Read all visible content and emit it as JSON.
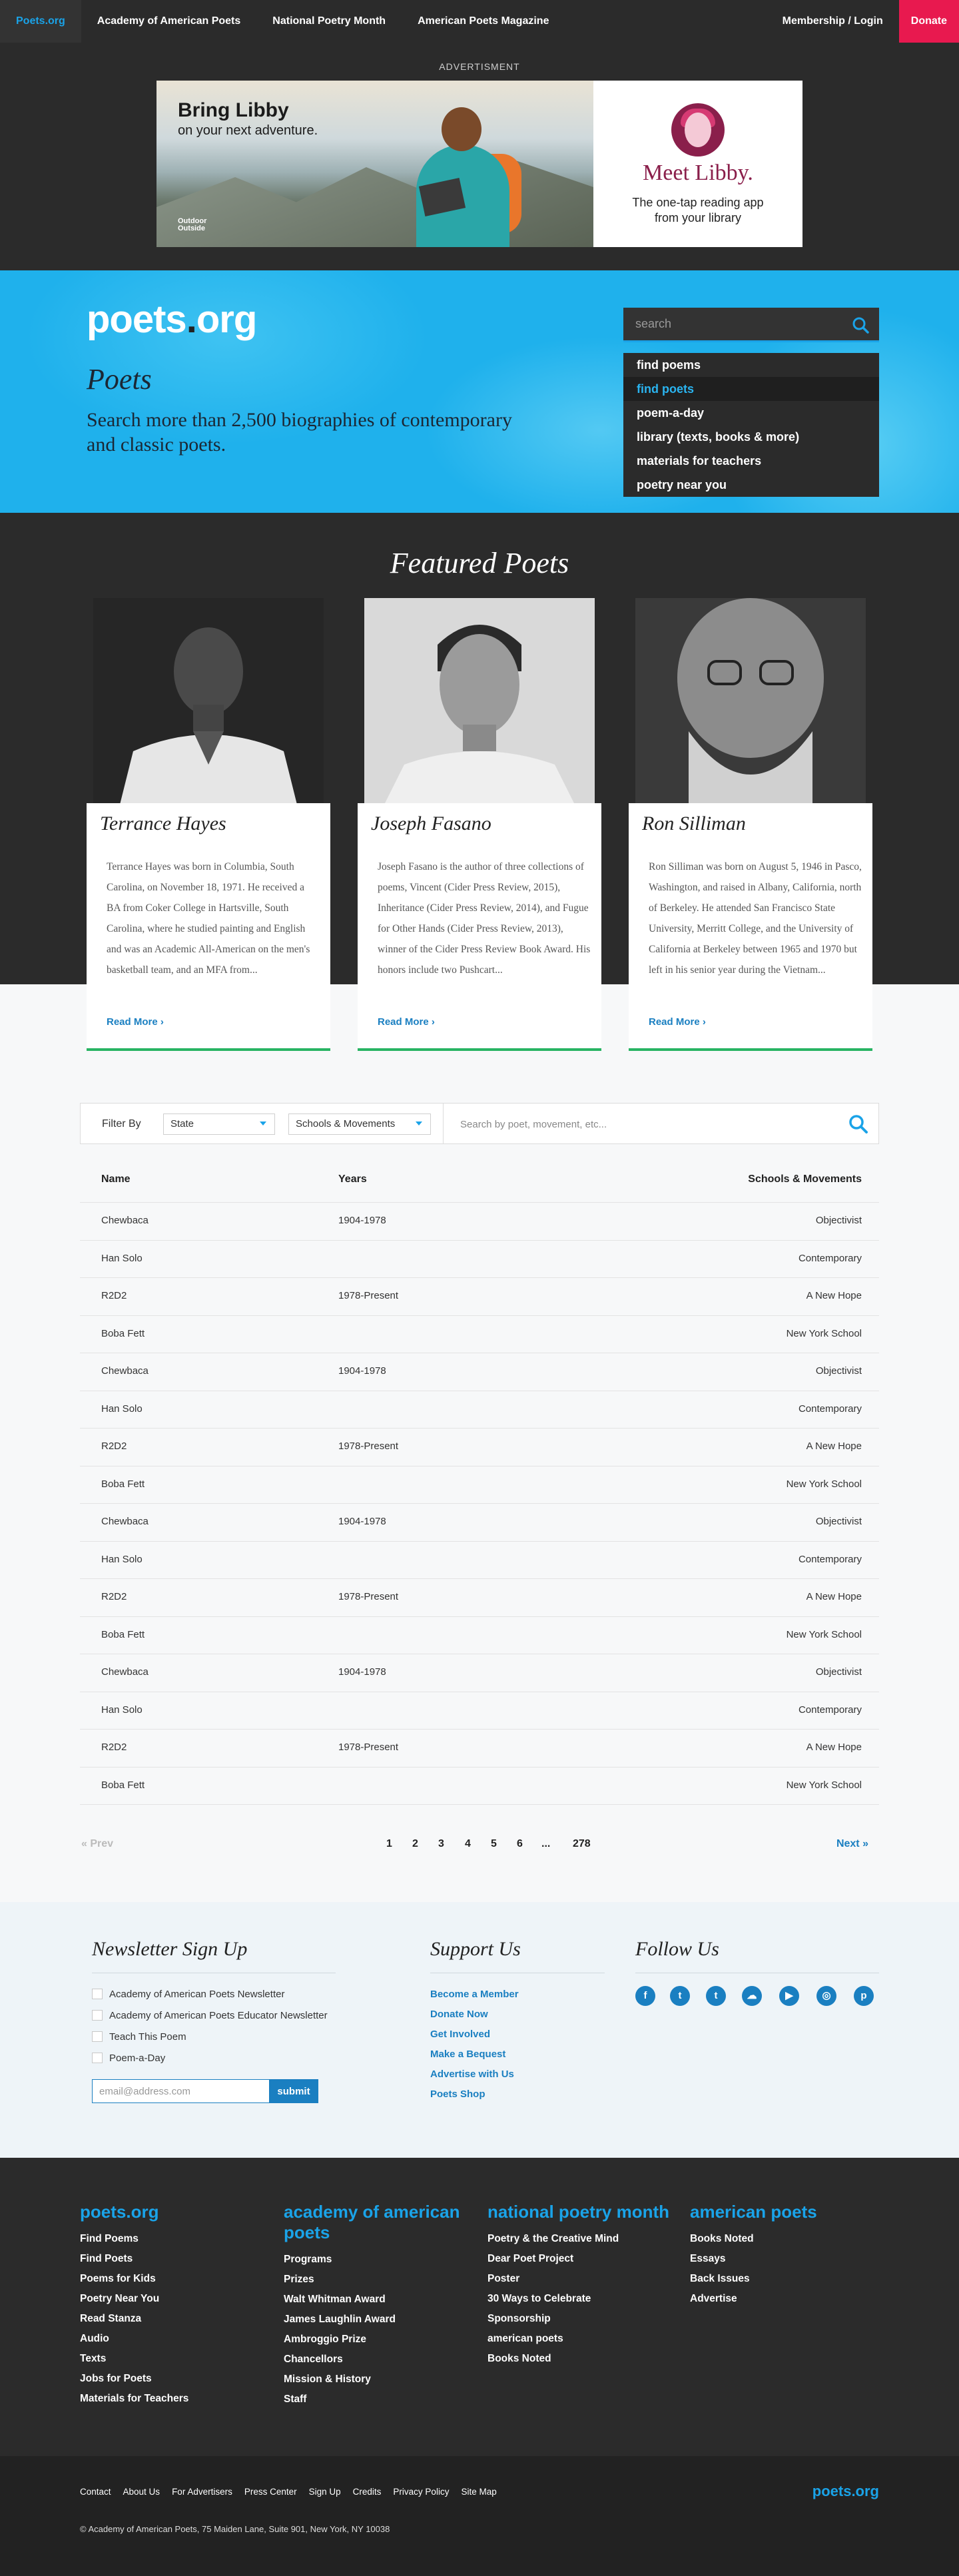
{
  "nav": {
    "home": "Poets.org",
    "items": [
      "Academy of American Poets",
      "National Poetry Month",
      "American Poets Magazine"
    ],
    "membership": "Membership / Login",
    "donate": "Donate"
  },
  "ad": {
    "label": "ADVERTISMENT",
    "headline": "Bring Libby",
    "subline": "on your next adventure.",
    "brand": "Outside",
    "brand_line2": "Outdoor",
    "meet": "Meet Libby.",
    "tagline_1": "The one-tap reading app",
    "tagline_2": "from your library"
  },
  "hero": {
    "logo_main": "poets",
    "logo_dot": ".",
    "logo_tail": "org",
    "title": "Poets",
    "subtitle": "Search more than 2,500 biographies of contemporary and classic poets.",
    "search_placeholder": "search",
    "menu": [
      "find poems",
      "find poets",
      "poem-a-day",
      "library (texts, books & more)",
      "materials for teachers",
      "poetry near you"
    ]
  },
  "featured": {
    "title": "Featured Poets",
    "read_more": "Read More",
    "poets": [
      {
        "name": "Terrance Hayes",
        "bio": "Terrance Hayes was born in Columbia, South Carolina, on November 18, 1971. He received a BA from Coker College in Hartsville, South Carolina, where he studied painting and English and was an Academic All-American on the men's basketball team, and an MFA from..."
      },
      {
        "name": "Joseph Fasano",
        "bio": "Joseph Fasano is the author of three collections of poems, Vincent (Cider Press Review, 2015), Inheritance (Cider Press Review, 2014), and Fugue for Other Hands (Cider Press Review, 2013), winner of the Cider Press Review Book Award. His honors include two Pushcart..."
      },
      {
        "name": "Ron Silliman",
        "bio": "Ron Silliman was born on August 5, 1946 in Pasco, Washington, and raised in Albany, California, north of Berkeley. He attended San Francisco State University, Merritt College, and the University of California at Berkeley between 1965 and 1970 but left in his senior year during the Vietnam..."
      }
    ]
  },
  "filter": {
    "label": "Filter By",
    "state": "State",
    "schools": "Schools & Movements",
    "search_placeholder": "Search by poet, movement, etc..."
  },
  "table": {
    "headers": [
      "Name",
      "Years",
      "Schools & Movements"
    ],
    "rows": [
      [
        "Chewbaca",
        "1904-1978",
        "Objectivist"
      ],
      [
        "Han Solo",
        "",
        "Contemporary"
      ],
      [
        "R2D2",
        "1978-Present",
        "A New Hope"
      ],
      [
        "Boba Fett",
        "",
        "New York School"
      ],
      [
        "Chewbaca",
        "1904-1978",
        "Objectivist"
      ],
      [
        "Han Solo",
        "",
        "Contemporary"
      ],
      [
        "R2D2",
        "1978-Present",
        "A New Hope"
      ],
      [
        "Boba Fett",
        "",
        "New York School"
      ],
      [
        "Chewbaca",
        "1904-1978",
        "Objectivist"
      ],
      [
        "Han Solo",
        "",
        "Contemporary"
      ],
      [
        "R2D2",
        "1978-Present",
        "A New Hope"
      ],
      [
        "Boba Fett",
        "",
        "New York School"
      ],
      [
        "Chewbaca",
        "1904-1978",
        "Objectivist"
      ],
      [
        "Han Solo",
        "",
        "Contemporary"
      ],
      [
        "R2D2",
        "1978-Present",
        "A New Hope"
      ],
      [
        "Boba Fett",
        "",
        "New York School"
      ]
    ]
  },
  "pagination": {
    "prev": "Prev",
    "pages": [
      "1",
      "2",
      "3",
      "4",
      "5",
      "6",
      "...",
      "278"
    ],
    "next": "Next"
  },
  "newsletter": {
    "title": "Newsletter Sign Up",
    "options": [
      "Academy of American Poets Newsletter",
      "Academy of American Poets Educator Newsletter",
      "Teach This Poem",
      "Poem-a-Day"
    ],
    "email_placeholder": "email@address.com",
    "submit": "submit"
  },
  "support": {
    "title": "Support Us",
    "links": [
      "Become a Member",
      "Donate Now",
      "Get Involved",
      "Make a Bequest",
      "Advertise with Us",
      "Poets Shop"
    ]
  },
  "follow": {
    "title": "Follow Us",
    "icons": [
      "facebook-icon",
      "twitter-icon",
      "tumblr-icon",
      "soundcloud-icon",
      "youtube-icon",
      "instagram-icon",
      "pinterest-icon"
    ]
  },
  "footer": {
    "columns": [
      {
        "title": "poets.org",
        "links": [
          "Find Poems",
          "Find Poets",
          "Poems for Kids",
          "Poetry Near You",
          "Read Stanza",
          "Audio",
          "Texts",
          "Jobs for Poets",
          "Materials for Teachers"
        ]
      },
      {
        "title": "academy of american poets",
        "links": [
          "Programs",
          "Prizes",
          "Walt Whitman Award",
          "James Laughlin Award",
          "Ambroggio Prize",
          "Chancellors",
          "Mission & History",
          "Staff"
        ]
      },
      {
        "title": "national poetry month",
        "links": [
          "Poetry & the Creative Mind",
          "Dear Poet Project",
          "Poster",
          "30 Ways to Celebrate",
          "Sponsorship",
          "american poets",
          "Books Noted"
        ]
      },
      {
        "title": "american poets",
        "links": [
          "Books Noted",
          "Essays",
          "Back Issues",
          "Advertise"
        ]
      }
    ],
    "bottom_links": [
      "Contact",
      "About Us",
      "For Advertisers",
      "Press Center",
      "Sign Up",
      "Credits",
      "Privacy Policy",
      "Site Map"
    ],
    "logo": "poets.org",
    "copyright": "© Academy of American Poets, 75 Maiden Lane, Suite 901, New York, NY 10038"
  },
  "colors": {
    "brand_blue": "#1aa3e8",
    "dark": "#2b2b2b",
    "donate_red": "#e8194f",
    "accent_green": "#28b463",
    "link_blue": "#1a7fc1"
  }
}
